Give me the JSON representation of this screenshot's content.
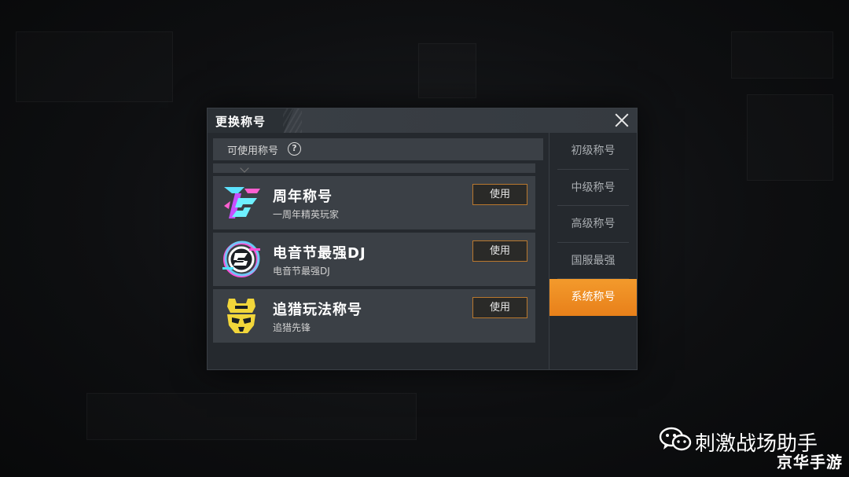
{
  "dialog": {
    "title": "更换称号",
    "section_label": "可使用称号",
    "help_glyph": "?",
    "use_label": "使用"
  },
  "titles": [
    {
      "name": "周年称号",
      "desc": "一周年精英玩家",
      "icon": "anniversary-1st-badge-icon"
    },
    {
      "name": "电音节最强DJ",
      "desc": "电音节最强DJ",
      "icon": "music-festival-dj-badge-icon"
    },
    {
      "name": "追猎玩法称号",
      "desc": "追猎先锋",
      "icon": "hunter-mask-badge-icon"
    }
  ],
  "side_nav": {
    "items": [
      {
        "label": "初级称号",
        "active": false
      },
      {
        "label": "中级称号",
        "active": false
      },
      {
        "label": "高级称号",
        "active": false
      },
      {
        "label": "国服最强",
        "active": false
      },
      {
        "label": "系统称号",
        "active": true
      }
    ]
  },
  "watermark": {
    "channel": "刺激战场助手",
    "corner": "京华手游",
    "icon": "wechat-icon"
  },
  "colors": {
    "accent_orange": "#ee8a22",
    "use_button_border": "#b9782e",
    "panel": "#25292e",
    "card": "#3b4046"
  }
}
